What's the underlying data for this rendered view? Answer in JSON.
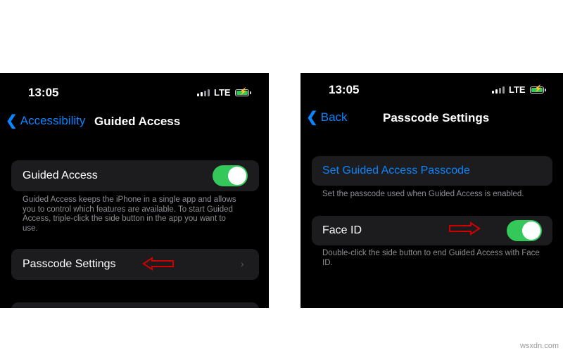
{
  "left_phone": {
    "status": {
      "time": "13:05",
      "network": "LTE"
    },
    "nav": {
      "back_label": "Accessibility",
      "title": "Guided Access"
    },
    "guided_access_row": {
      "label": "Guided Access",
      "toggle_on": true
    },
    "guided_access_footer": "Guided Access keeps the iPhone in a single app and allows you to control which features are available. To start Guided Access, triple-click the side button in the app you want to use.",
    "passcode_row": {
      "label": "Passcode Settings"
    }
  },
  "right_phone": {
    "status": {
      "time": "13:05",
      "network": "LTE"
    },
    "nav": {
      "back_label": "Back",
      "title": "Passcode Settings"
    },
    "set_passcode_row": {
      "label": "Set Guided Access Passcode"
    },
    "set_passcode_footer": "Set the passcode used when Guided Access is enabled.",
    "face_id_row": {
      "label": "Face ID",
      "toggle_on": true
    },
    "face_id_footer": "Double-click the side button to end Guided Access with Face ID."
  },
  "icons": [
    "chevron-left-icon",
    "chevron-right-icon",
    "signal-icon",
    "battery-charging-icon",
    "red-arrow-icon"
  ],
  "colors": {
    "accent": "#0a84ff",
    "toggle_on": "#34c759",
    "arrow": "#d00000",
    "card": "#1c1c1e"
  },
  "watermark": "wsxdn.com"
}
